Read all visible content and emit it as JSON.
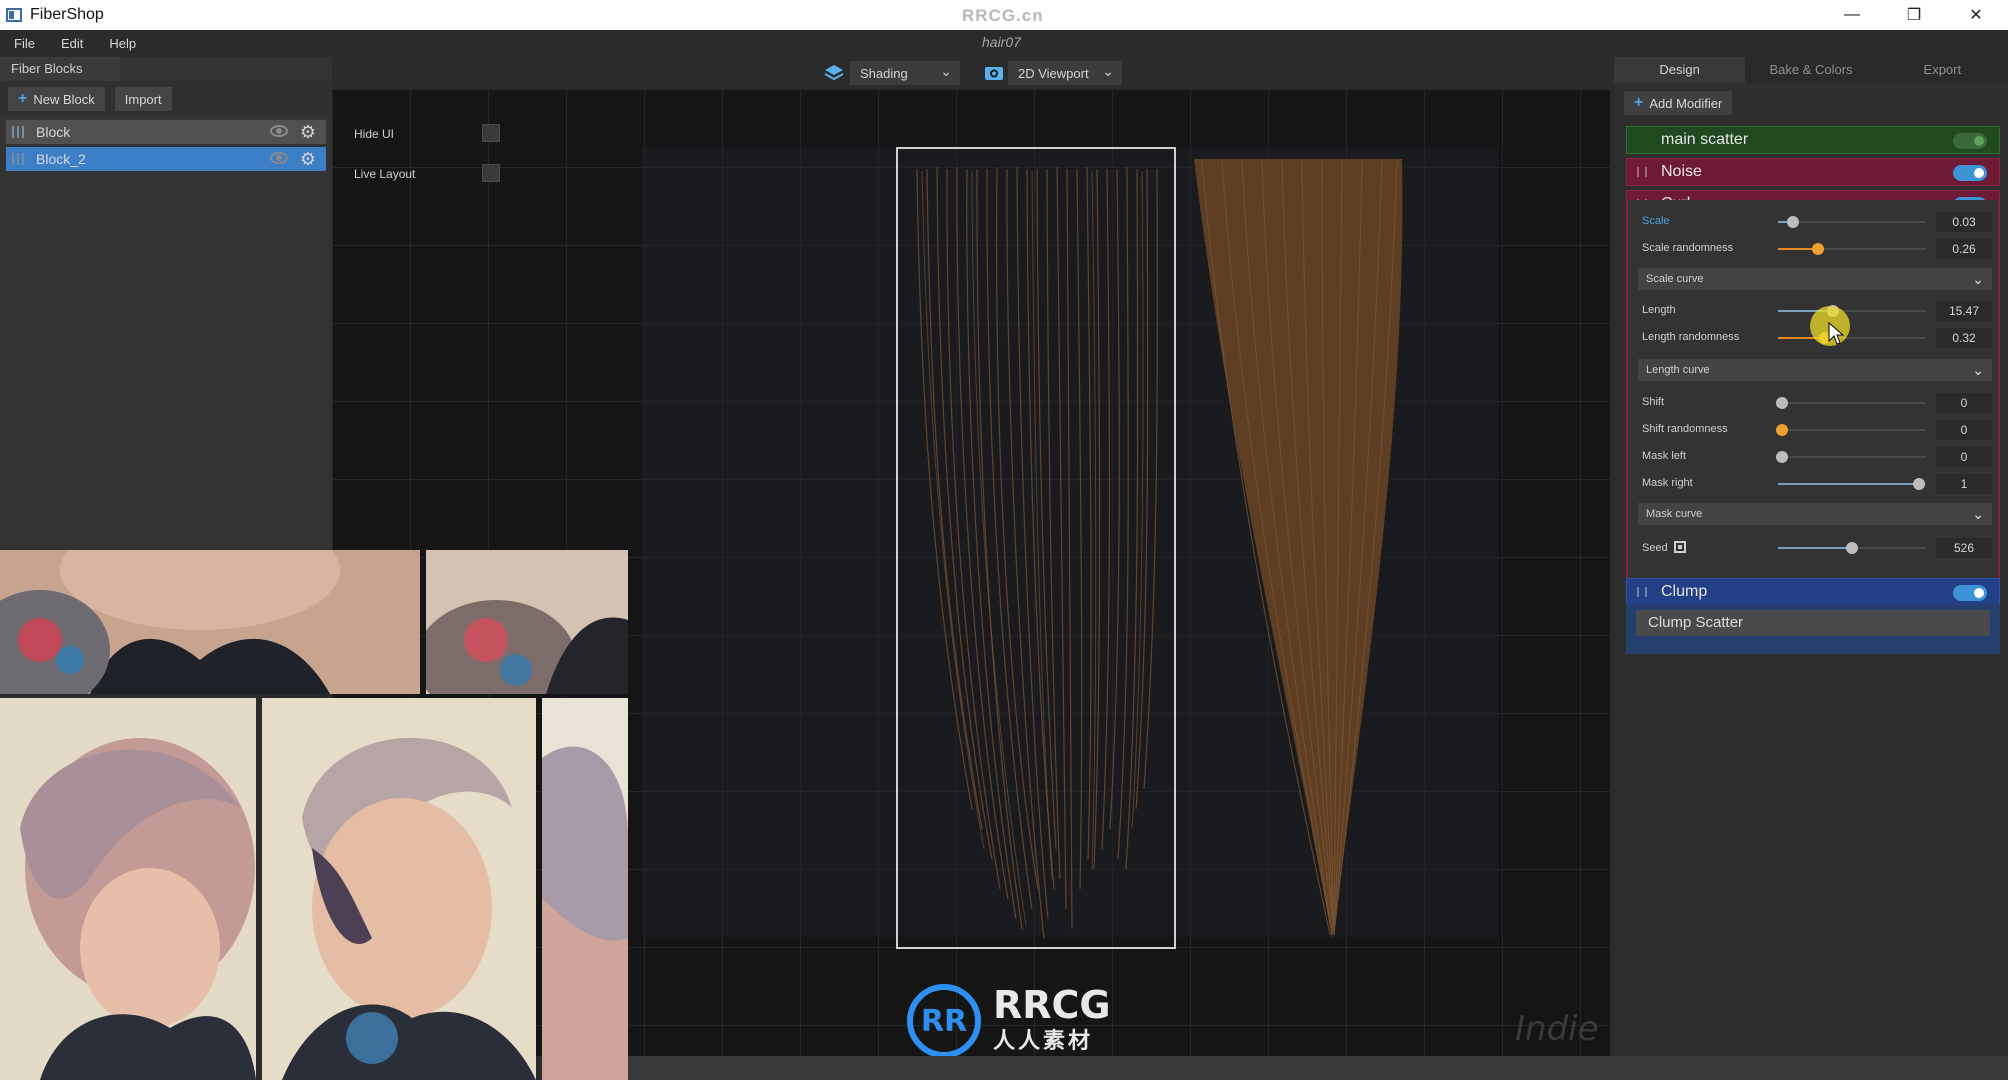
{
  "app": {
    "title": "FiberShop",
    "watermark": "RRCG.cn",
    "document": "hair07"
  },
  "window": {
    "minimize": "—",
    "restore": "❐",
    "close": "✕"
  },
  "menu": [
    "File",
    "Edit",
    "Help"
  ],
  "left_panel": {
    "header": "Fiber Blocks",
    "new_block": "New Block",
    "import": "Import",
    "blocks": [
      {
        "label": "Block",
        "selected": false
      },
      {
        "label": "Block_2",
        "selected": true
      }
    ]
  },
  "viewport": {
    "shading": "Shading",
    "view_mode": "2D Viewport",
    "hide_ui": "Hide UI",
    "live_layout": "Live Layout",
    "edition": "Indie",
    "logo_main": "RRCG",
    "logo_sub": "人人素材",
    "logo_mark": "RR"
  },
  "right_panel": {
    "tabs": [
      {
        "label": "Design",
        "active": true
      },
      {
        "label": "Bake & Colors",
        "active": false
      },
      {
        "label": "Export",
        "active": false
      }
    ],
    "add_modifier": "Add Modifier",
    "modifiers": {
      "main_scatter": "main scatter",
      "noise": "Noise",
      "curl": "Curl",
      "clump": "Clump",
      "clump_scatter": "Clump Scatter"
    },
    "curl_params": {
      "scale": {
        "label": "Scale",
        "value": "0.03",
        "pos": 0.1
      },
      "scale_randomness": {
        "label": "Scale randomness",
        "value": "0.26",
        "pos": 0.27
      },
      "scale_curve": "Scale curve",
      "length": {
        "label": "Length",
        "value": "15.47",
        "pos": 0.37
      },
      "length_randomness": {
        "label": "Length randomness",
        "value": "0.32",
        "pos": 0.32
      },
      "length_curve": "Length curve",
      "shift": {
        "label": "Shift",
        "value": "0",
        "pos": 0.03
      },
      "shift_randomness": {
        "label": "Shift randomness",
        "value": "0",
        "pos": 0.03
      },
      "mask_left": {
        "label": "Mask left",
        "value": "0",
        "pos": 0.03
      },
      "mask_right": {
        "label": "Mask right",
        "value": "1",
        "pos": 0.95
      },
      "mask_curve": "Mask curve",
      "seed": {
        "label": "Seed",
        "value": "526",
        "pos": 0.5
      }
    }
  },
  "colors": {
    "accent": "#3c93d6",
    "main_scatter": "#1f5a1f",
    "noise": "#7a1c38",
    "curl": "#7a1c38",
    "clump": "#233f86",
    "orange_slider": "#f0a030"
  }
}
